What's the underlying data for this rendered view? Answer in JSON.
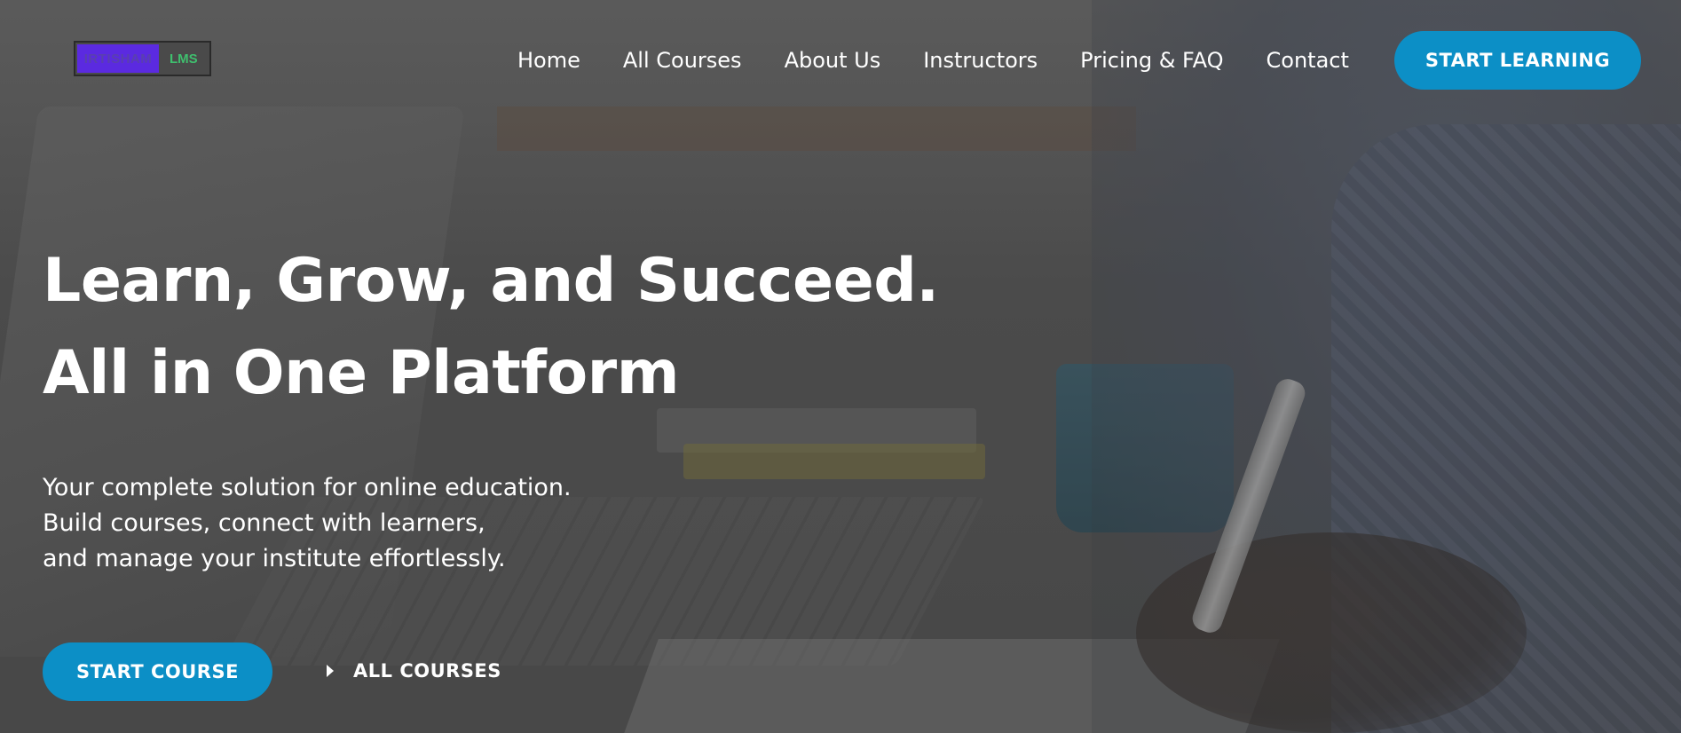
{
  "logo": {
    "brand_text": "IRTISHAM",
    "suffix_text": "LMS",
    "colors": {
      "mark": "#5b2ae0",
      "suffix": "#3fbf6e"
    }
  },
  "nav": {
    "items": [
      {
        "label": "Home"
      },
      {
        "label": "All Courses"
      },
      {
        "label": "About Us"
      },
      {
        "label": "Instructors"
      },
      {
        "label": "Pricing & FAQ"
      },
      {
        "label": "Contact"
      }
    ]
  },
  "header": {
    "cta_label": "START LEARNING"
  },
  "hero": {
    "headline_line1": "Learn, Grow, and Succeed.",
    "headline_line2": "All in One Platform",
    "sub_line1": "Your complete solution for online education.",
    "sub_line2": "Build courses, connect with learners,",
    "sub_line3": "and manage your institute effortlessly.",
    "primary_button": "START COURSE",
    "secondary_link": "ALL COURSES",
    "secondary_icon": "caret-right-icon"
  },
  "theme": {
    "accent": "#0c8fc6",
    "text": "#ffffff"
  }
}
